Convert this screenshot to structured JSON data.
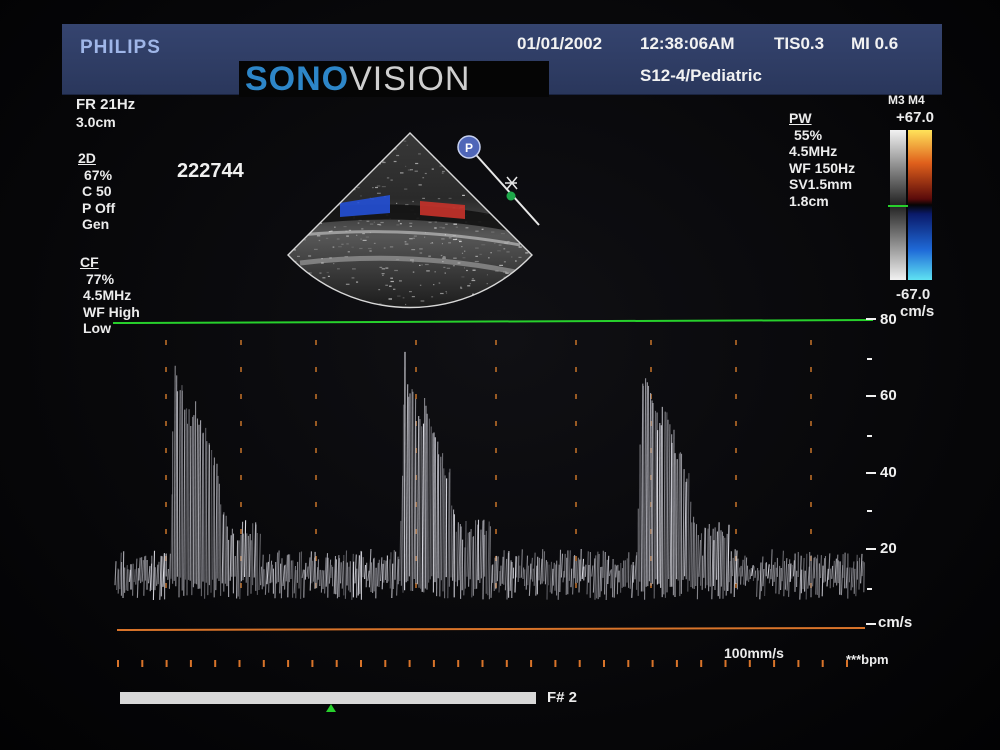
{
  "header": {
    "brand": "PHILIPS",
    "date": "01/01/2002",
    "time": "12:38:06AM",
    "tis": "TIS0.3",
    "mi": "MI 0.6",
    "probe_preset": "S12-4/Pediatric"
  },
  "watermark": {
    "part1": "SONO",
    "part2": "VISION"
  },
  "left_params": {
    "fr": "FR 21Hz",
    "depth": "3.0cm",
    "twod_title": "2D",
    "twod_lines": [
      "67%",
      "C 50",
      "P Off",
      "Gen"
    ],
    "cf_title": "CF",
    "cf_lines": [
      "77%",
      "4.5MHz",
      "WF High",
      "Low"
    ],
    "patient_id": "222744"
  },
  "right_params": {
    "pw_title": "PW",
    "pw_lines": [
      "55%",
      "4.5MHz",
      "WF 150Hz",
      "SV1.5mm",
      "1.8cm"
    ],
    "map_label": "M3 M4",
    "scale_top": "+67.0",
    "scale_bottom": "-67.0",
    "scale_unit": "cm/s"
  },
  "spectral": {
    "axis_labels": [
      "80",
      "60",
      "40",
      "20"
    ],
    "unit_label": "cm/s",
    "sweep_speed": "100mm/s",
    "heart_rate": "***bpm",
    "frame_label": "F# 2"
  },
  "colors": {
    "header_bg": "#2f3d66",
    "brand": "#9fb6e8",
    "velocity_line": "#27d02c",
    "baseline": "#d9742a",
    "timing_ticks": "#d9742a",
    "flow_red": "#c6322a",
    "flow_blue": "#2450d6"
  },
  "icons": [
    "pulse-wave-sample-gate-icon",
    "probe-orientation-marker-icon",
    "color-velocity-scale-bar",
    "frame-position-marker-icon"
  ]
}
